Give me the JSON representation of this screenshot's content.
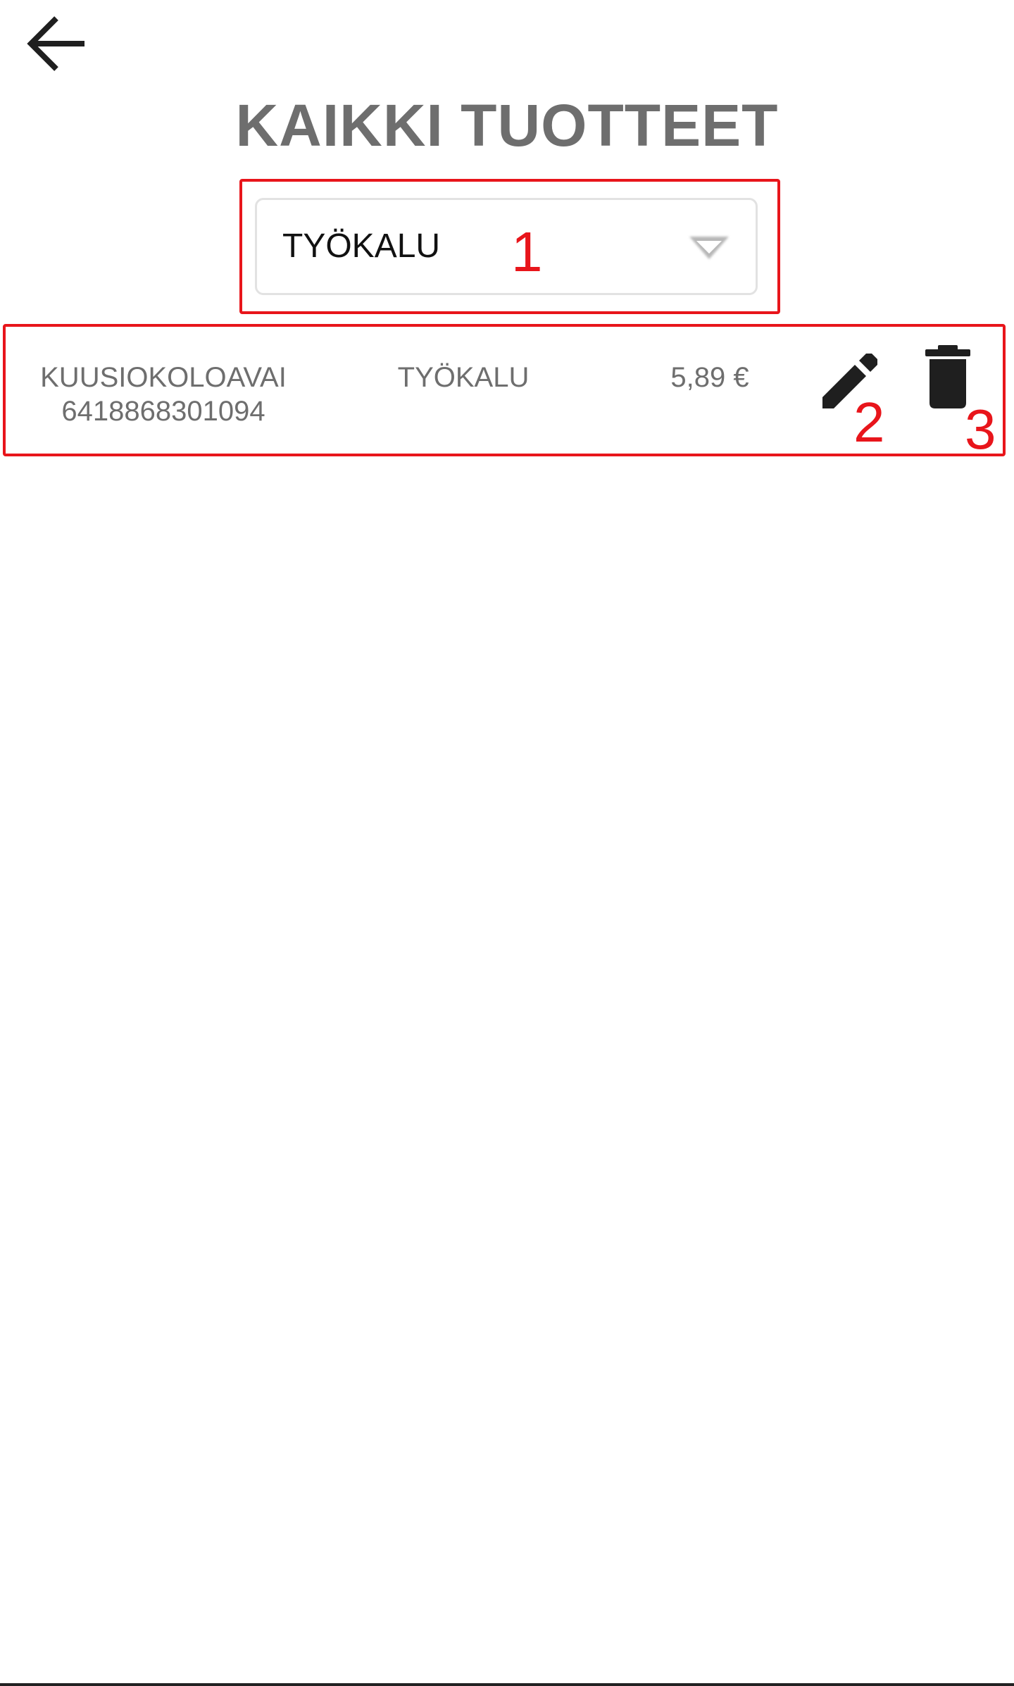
{
  "header": {
    "title": "KAIKKI TUOTTEET"
  },
  "filter": {
    "selected_value": "TYÖKALU",
    "caret_icon": "triangle-down-icon"
  },
  "products": [
    {
      "name": "KUUSIOKOLOAVAI",
      "barcode": "6418868301094",
      "category": "TYÖKALU",
      "price": "5,89 €",
      "edit_icon": "pencil-icon",
      "delete_icon": "trash-icon"
    }
  ],
  "annotations": {
    "color": "#e8151b",
    "labels": [
      "1",
      "2",
      "3"
    ]
  },
  "colors": {
    "title": "#6e6e6e",
    "row_text": "#6e6e6e",
    "icon": "#1f1f1f",
    "annotation": "#e8151b"
  }
}
